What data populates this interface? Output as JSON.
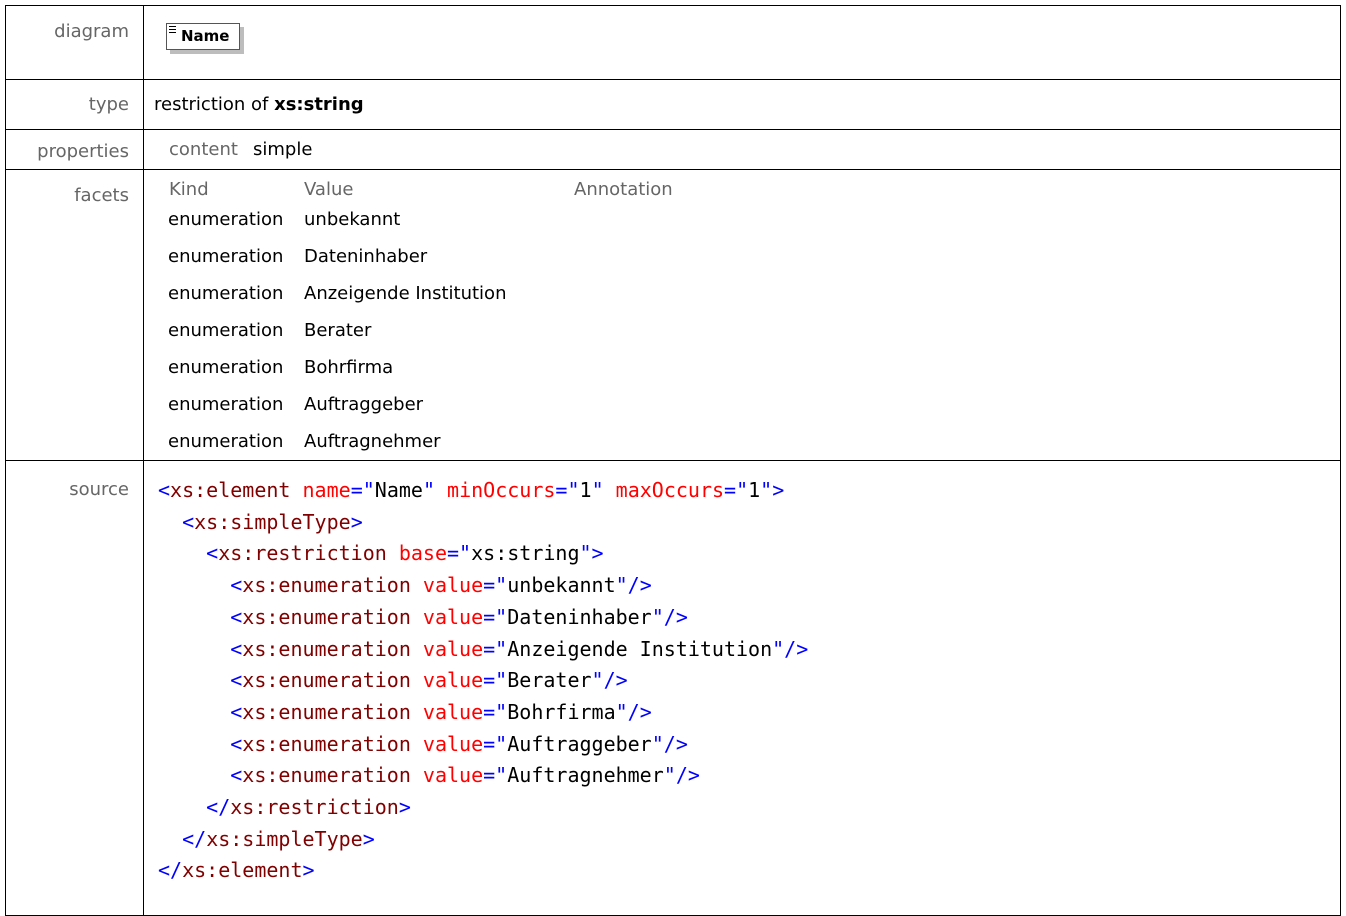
{
  "labels": {
    "diagram": "diagram",
    "type": "type",
    "properties": "properties",
    "facets": "facets",
    "source": "source"
  },
  "diagram": {
    "element_name": "Name"
  },
  "type": {
    "prefix": "restriction of ",
    "base": "xs:string"
  },
  "properties": {
    "key": "content",
    "value": "simple"
  },
  "facets": {
    "headers": [
      "Kind",
      "Value",
      "Annotation"
    ],
    "rows": [
      {
        "kind": "enumeration",
        "value": "unbekannt"
      },
      {
        "kind": "enumeration",
        "value": "Dateninhaber"
      },
      {
        "kind": "enumeration",
        "value": "Anzeigende Institution"
      },
      {
        "kind": "enumeration",
        "value": "Berater"
      },
      {
        "kind": "enumeration",
        "value": "Bohrfirma"
      },
      {
        "kind": "enumeration",
        "value": "Auftraggeber"
      },
      {
        "kind": "enumeration",
        "value": "Auftragnehmer"
      }
    ]
  },
  "source": {
    "element": {
      "name": "Name",
      "minOccurs": "1",
      "maxOccurs": "1"
    },
    "restriction_base": "xs:string",
    "enumerations": [
      "unbekannt",
      "Dateninhaber",
      "Anzeigende Institution",
      "Berater",
      "Bohrfirma",
      "Auftraggeber",
      "Auftragnehmer"
    ]
  },
  "colors": {
    "bracket": "#0000ff",
    "tag_name": "#800000",
    "attribute_name": "#ff0000",
    "label": "#666666"
  }
}
